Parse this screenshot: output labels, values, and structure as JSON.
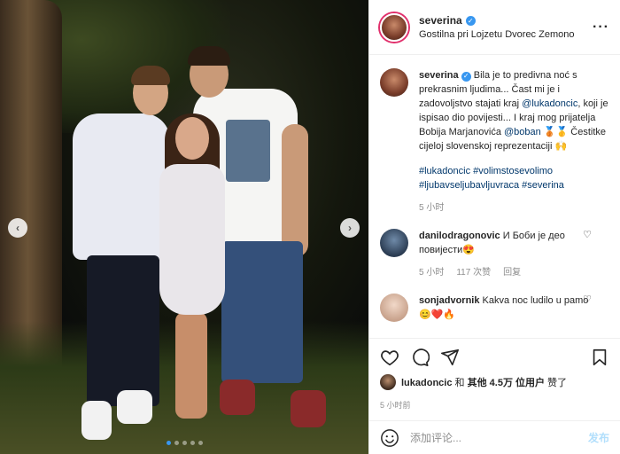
{
  "post": {
    "username": "severina",
    "location": "Gostilna pri Lojzetu Dvorec Zemono",
    "more_icon": "more-dots-icon"
  },
  "carousel": {
    "prev_icon": "‹",
    "next_icon": "›",
    "slides": 5,
    "active_index": 0
  },
  "caption": {
    "username": "severina",
    "text_part1": "Bila je to predivna noć s prekrasnim ljudima... Čast mi je i zadovoljstvo stajati kraj ",
    "mention1": "@lukadoncic",
    "text_part2": ", koji je ispisao dio povijesti... I kraj mog prijatelja Bobija Marjanovića ",
    "mention2": "@boban",
    "text_part3": " 🥉🥇 Čestitke cijeloj slovenskoj reprezentaciji 🙌",
    "hashtags_line1": "#lukadoncic #volimstosevolimo",
    "hashtags_line2": "#ljubavseljubavljuvraca #severina",
    "time": "5 小时"
  },
  "comments": [
    {
      "username": "danilodragonovic",
      "text": "И Боби је део повијести😍",
      "time": "5 小时",
      "likes": "117 次赞",
      "reply": "回复"
    },
    {
      "username": "sonjadvornik",
      "text": "Kakva noc ludilo u pamo😊❤️🔥"
    }
  ],
  "likes": {
    "user": "lukadoncic",
    "text_middle": " 和 ",
    "others": "其他 4.5万 位用户",
    "text_end": " 赞了"
  },
  "time_posted": "5 小时前",
  "add_comment": {
    "placeholder": "添加评论...",
    "post_label": "发布"
  },
  "colors": {
    "link": "#00376b",
    "accent": "#3897f0",
    "post_disabled": "#b2dffc"
  }
}
